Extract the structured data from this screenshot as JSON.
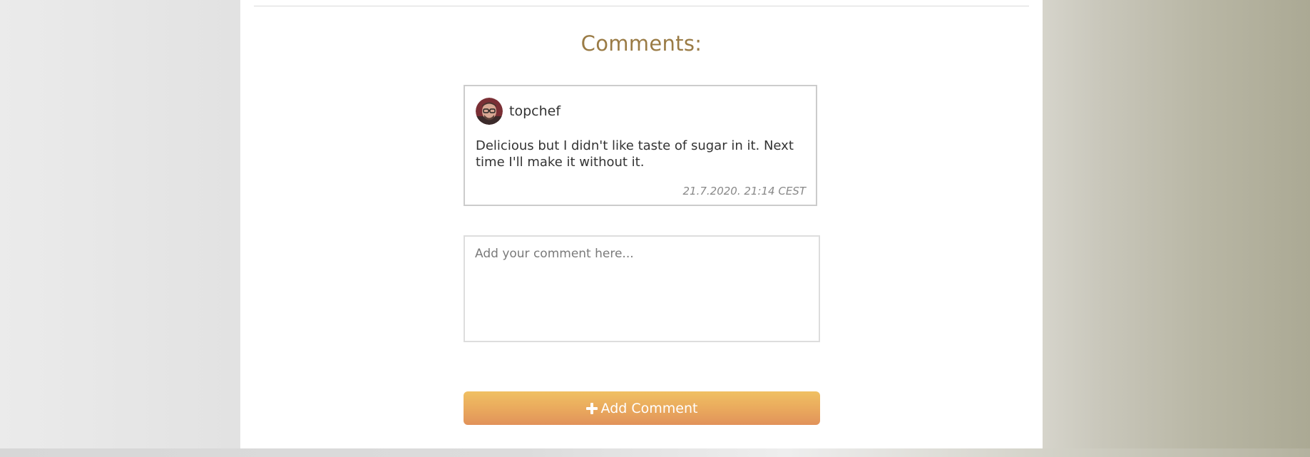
{
  "comments_section": {
    "title": "Comments:",
    "comments": [
      {
        "username": "topchef",
        "avatar_icon": "user-avatar-photo",
        "text": "Delicious but I didn't like taste of sugar in it. Next time I'll make it without it.",
        "timestamp": "21.7.2020. 21:14 CEST"
      }
    ],
    "input": {
      "placeholder": "Add your comment here...",
      "value": ""
    },
    "add_button": {
      "label": "Add Comment",
      "icon": "plus-icon"
    }
  },
  "colors": {
    "title": "#9a7b45",
    "button_top": "#f0c062",
    "button_bottom": "#e1925a",
    "card_border": "#cccccc"
  }
}
